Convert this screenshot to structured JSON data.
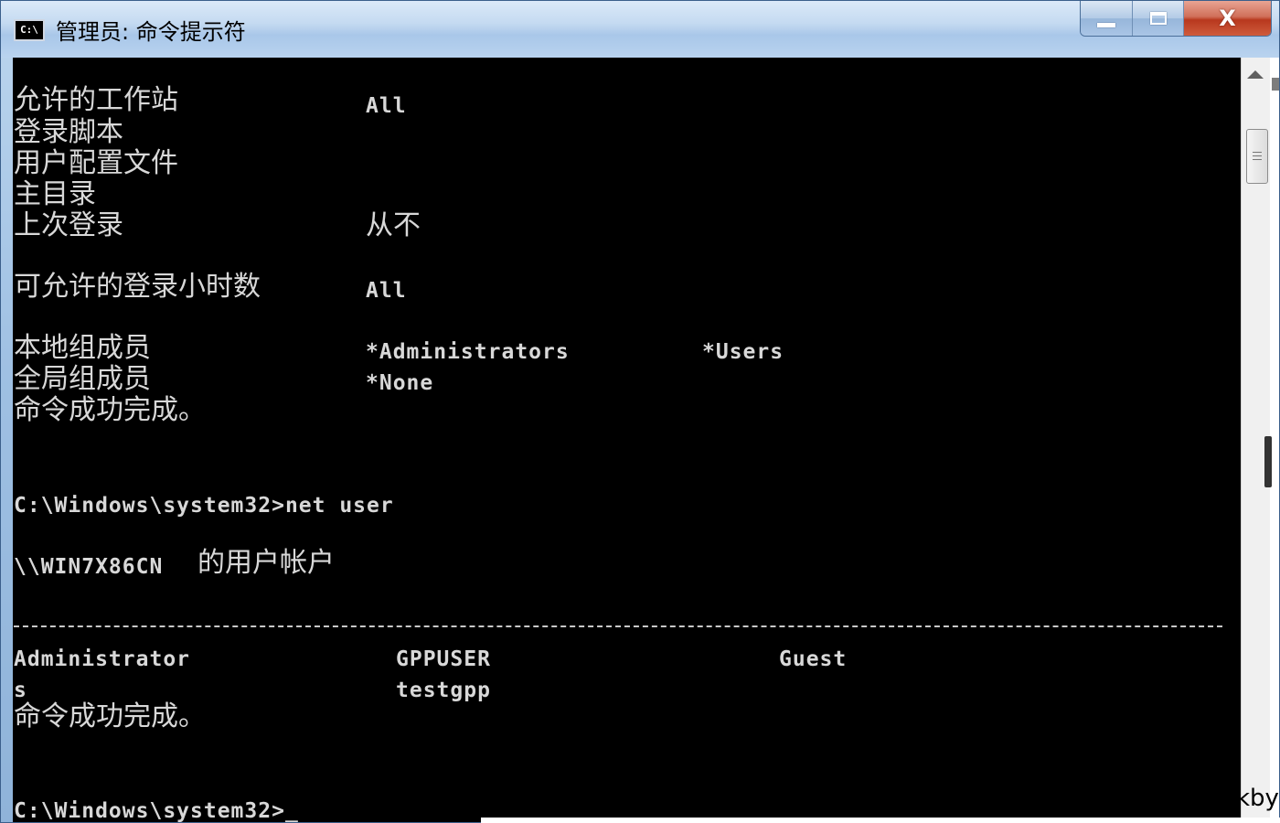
{
  "window": {
    "title": "管理员: 命令提示符",
    "icon_text": "C:\\",
    "minimize_label": "minimize",
    "maximize_label": "maximize",
    "close_label": "X"
  },
  "console": {
    "fields": [
      {
        "label": "允许的工作站",
        "value": "All"
      },
      {
        "label": "登录脚本",
        "value": ""
      },
      {
        "label": "用户配置文件",
        "value": ""
      },
      {
        "label": "主目录",
        "value": ""
      },
      {
        "label": "上次登录",
        "value": "从不"
      },
      {
        "label": "可允许的登录小时数",
        "value": "All"
      },
      {
        "label": "本地组成员",
        "value": "*Administrators",
        "value2": "*Users"
      },
      {
        "label": "全局组成员",
        "value": "*None"
      }
    ],
    "success_1": "命令成功完成。",
    "prompt_1": "C:\\Windows\\system32>net user",
    "accounts_host": "\\\\WIN7X86CN",
    "accounts_title": "的用户帐户",
    "accounts": [
      [
        "Administrator",
        "GPPUSER",
        "Guest"
      ],
      [
        "s",
        "testgpp",
        ""
      ]
    ],
    "success_2": "命令成功完成。",
    "prompt_2": "C:\\Windows\\system32>_"
  },
  "overlay": {
    "watermark": "kby"
  }
}
